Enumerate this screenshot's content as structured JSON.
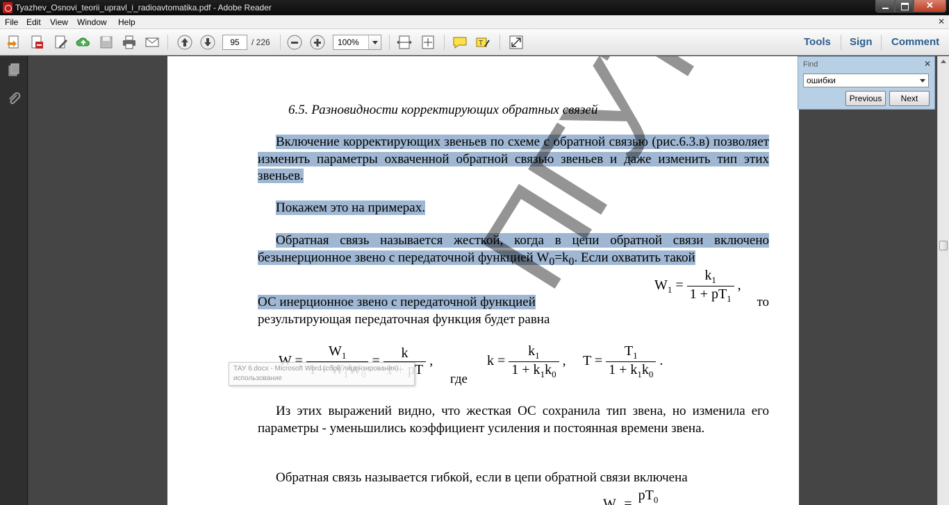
{
  "window": {
    "title": "Tyazhev_Osnovi_teorii_upravl_i_radioavtomatika.pdf - Adobe Reader"
  },
  "menu": [
    "File",
    "Edit",
    "View",
    "Window",
    "Help"
  ],
  "toolbar": {
    "page_current": "95",
    "page_total": "/ 226",
    "zoom": "100%",
    "tools_label": "Tools",
    "sign_label": "Sign",
    "comment_label": "Comment"
  },
  "find": {
    "label": "Find",
    "query": "ошибки",
    "previous_label": "Previous",
    "next_label": "Next"
  },
  "document": {
    "heading": "6.5.  Разновидности корректирующих обратных связей",
    "p1": "Включение корректирующих звеньев по схеме с обратной связью (рис.6.3.в) позволяет изменить параметры охваченной обратной связью звеньев и даже изменить тип этих звеньев.",
    "p2": "Покажем это на примерах.",
    "p3_a": "Обратная связь называется жесткой, когда в цепи обратной связи включено безынерционное звено с передаточной функцией  ",
    "p3_formula": "W",
    "p3_formula_sub": "0",
    "p3_formula_mid": "=k",
    "p3_formula_sub2": "0",
    "p3_b": ". Если охватить такой",
    "p4_a": "ОС    инерционное    звено    с    передаточной    функцией",
    "p4_b": "то",
    "p4_c": "результирующая передаточная функция будет равна",
    "where": "где",
    "p5": "Из этих выражений видно, что жесткая ОС сохранила тип звена, но изменила его параметры - уменьшились коэффициент усиления и постоянная времени звена.",
    "p6": "Обратная связь называется гибкой, если в цепи обратной связи включена",
    "watermark": "ПГУТИ",
    "tooltip_line1": "ТАУ 6.docx - Microsoft Word (сбой лицензирования)",
    "tooltip_line2": "использование"
  }
}
